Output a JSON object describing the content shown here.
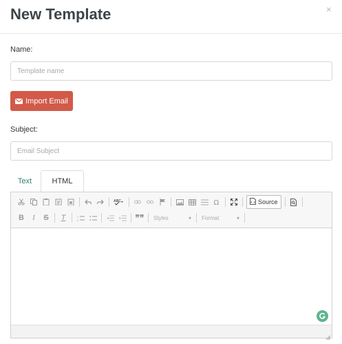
{
  "modal": {
    "title": "New Template",
    "close_symbol": "×"
  },
  "form": {
    "name_label": "Name:",
    "name_placeholder": "Template name",
    "name_value": "",
    "import_label": "Import Email",
    "subject_label": "Subject:",
    "subject_placeholder": "Email Subject",
    "subject_value": ""
  },
  "tabs": [
    {
      "label": "Text",
      "active": false
    },
    {
      "label": "HTML",
      "active": true
    }
  ],
  "editor": {
    "source_label": "Source",
    "styles_label": "Styles",
    "format_label": "Format",
    "body_text": ""
  },
  "colors": {
    "import_button": "#d25a49",
    "text_tab": "#2e7d6e",
    "grammarly": "#5bb58c"
  },
  "icons": {
    "toolbar_row1": [
      "cut-icon",
      "copy-icon",
      "paste-icon",
      "paste-text-icon",
      "paste-word-icon",
      "undo-icon",
      "redo-icon",
      "spellcheck-icon",
      "link-icon",
      "unlink-icon",
      "anchor-icon",
      "image-icon",
      "table-icon",
      "horizontal-line-icon",
      "special-char-icon",
      "maximize-icon",
      "source-icon",
      "preview-icon"
    ],
    "toolbar_row2": [
      "bold-icon",
      "italic-icon",
      "strike-icon",
      "remove-format-icon",
      "numbered-list-icon",
      "bullet-list-icon",
      "outdent-icon",
      "indent-icon",
      "blockquote-icon"
    ]
  }
}
